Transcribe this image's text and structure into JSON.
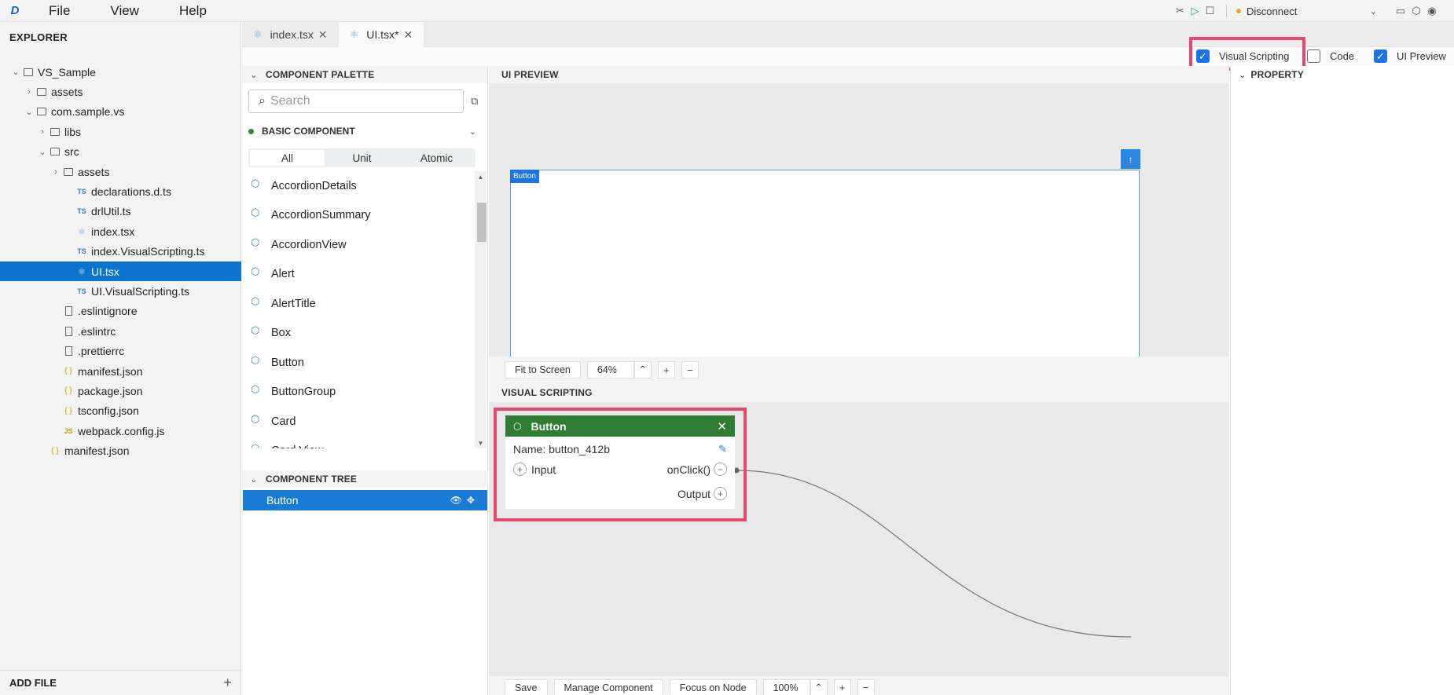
{
  "menubar": {
    "logo": "D",
    "items": [
      "File",
      "View",
      "Help"
    ],
    "connection": {
      "label": "Disconnect",
      "status_color": "#f0a030"
    }
  },
  "explorer": {
    "title": "EXPLORER",
    "add_file": "ADD FILE",
    "tree": [
      {
        "label": "VS_Sample",
        "depth": 0,
        "type": "folder",
        "expanded": true
      },
      {
        "label": "assets",
        "depth": 1,
        "type": "folder",
        "expanded": false
      },
      {
        "label": "com.sample.vs",
        "depth": 1,
        "type": "folder",
        "expanded": true
      },
      {
        "label": "libs",
        "depth": 2,
        "type": "folder",
        "expanded": false
      },
      {
        "label": "src",
        "depth": 2,
        "type": "folder",
        "expanded": true
      },
      {
        "label": "assets",
        "depth": 3,
        "type": "folder",
        "expanded": false
      },
      {
        "label": "declarations.d.ts",
        "depth": 4,
        "type": "ts"
      },
      {
        "label": "drlUtil.ts",
        "depth": 4,
        "type": "ts"
      },
      {
        "label": "index.tsx",
        "depth": 4,
        "type": "react"
      },
      {
        "label": "index.VisualScripting.ts",
        "depth": 4,
        "type": "ts"
      },
      {
        "label": "UI.tsx",
        "depth": 4,
        "type": "react",
        "selected": true
      },
      {
        "label": "UI.VisualScripting.ts",
        "depth": 4,
        "type": "ts"
      },
      {
        "label": ".eslintignore",
        "depth": 3,
        "type": "file"
      },
      {
        "label": ".eslintrc",
        "depth": 3,
        "type": "file"
      },
      {
        "label": ".prettierrc",
        "depth": 3,
        "type": "file"
      },
      {
        "label": "manifest.json",
        "depth": 3,
        "type": "json"
      },
      {
        "label": "package.json",
        "depth": 3,
        "type": "json"
      },
      {
        "label": "tsconfig.json",
        "depth": 3,
        "type": "json"
      },
      {
        "label": "webpack.config.js",
        "depth": 3,
        "type": "js"
      },
      {
        "label": "manifest.json",
        "depth": 2,
        "type": "json"
      }
    ]
  },
  "tabs": [
    {
      "label": "index.tsx",
      "active": false
    },
    {
      "label": "UI.tsx*",
      "active": true
    }
  ],
  "view_toggles": [
    {
      "label": "Visual Scripting",
      "checked": true,
      "highlighted": true
    },
    {
      "label": "Code",
      "checked": false
    },
    {
      "label": "UI Preview",
      "checked": true
    }
  ],
  "palette": {
    "title": "COMPONENT PALETTE",
    "search_placeholder": "Search",
    "group_title": "BASIC COMPONENT",
    "filters": [
      "All",
      "Unit",
      "Atomic"
    ],
    "active_filter": "All",
    "components": [
      "AccordionDetails",
      "AccordionSummary",
      "AccordionView",
      "Alert",
      "AlertTitle",
      "Box",
      "Button",
      "ButtonGroup",
      "Card",
      "Card View"
    ]
  },
  "component_tree": {
    "title": "COMPONENT TREE",
    "selected_item": "Button"
  },
  "preview": {
    "title": "UI PREVIEW",
    "tag": "Button",
    "fit_label": "Fit to Screen",
    "zoom": "64%"
  },
  "visual_scripting": {
    "title": "VISUAL SCRIPTING",
    "node": {
      "title": "Button",
      "name_label": "Name: button_412b",
      "input_label": "Input",
      "event_label": "onClick()",
      "output_label": "Output",
      "header_color": "#2e7d32"
    },
    "buttons": [
      "Save",
      "Manage Component",
      "Focus on Node"
    ],
    "zoom": "100%"
  },
  "property": {
    "title": "PROPERTY"
  },
  "colors": {
    "highlight": "#e8476e",
    "accent": "#1a73e8",
    "selection": "#0a74d0"
  }
}
